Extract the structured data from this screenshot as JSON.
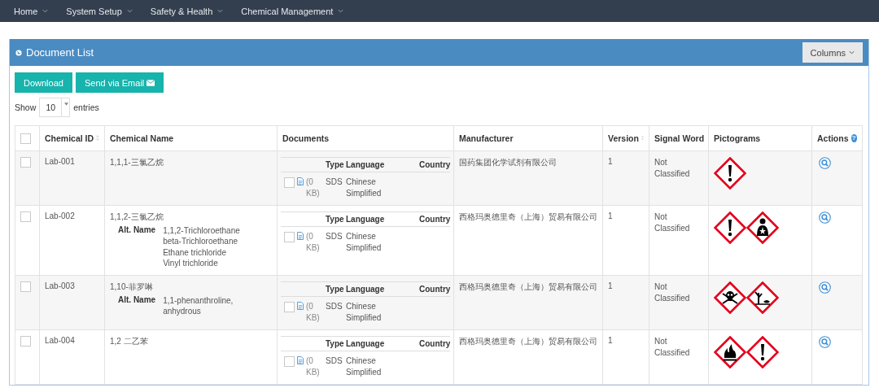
{
  "nav": [
    {
      "label": "Home"
    },
    {
      "label": "System Setup"
    },
    {
      "label": "Safety & Health"
    },
    {
      "label": "Chemical Management"
    }
  ],
  "panel": {
    "title": "Document List",
    "columns_button": "Columns"
  },
  "buttons": [
    {
      "label": "Download",
      "kind": "plain"
    },
    {
      "label": "Send via Email",
      "kind": "email"
    }
  ],
  "length": {
    "before": "Show",
    "value": "10",
    "after": "entries"
  },
  "table": {
    "select_all": {
      "checked": false
    },
    "columns": [
      {
        "label": "Chemical ID",
        "kind": "sortable"
      },
      {
        "label": "Chemical Name",
        "kind": "plain"
      },
      {
        "label": "Documents",
        "kind": "plain"
      },
      {
        "label": "Manufacturer",
        "kind": "plain"
      },
      {
        "label": "Version",
        "kind": "sortable"
      },
      {
        "label": "Signal Word",
        "kind": "plain"
      },
      {
        "label": "Pictograms",
        "kind": "plain"
      },
      {
        "label": "Actions",
        "kind": "help",
        "help_mark": "?"
      }
    ],
    "rows": [
      {
        "checked": false,
        "id": "Lab-001",
        "name": "1,1,1-三氯乙烷",
        "documents": {
          "headers": [
            "Type",
            "Language",
            "Country"
          ],
          "items": [
            {
              "checked": false,
              "size": "(0 KB)",
              "type": "SDS",
              "language": "Chinese Simplified"
            }
          ]
        },
        "manufacturer": "国药集团化学试剂有限公司",
        "version": "1",
        "signal_word": "Not Classified",
        "pictograms": [
          {
            "kind": "exclamation"
          }
        ]
      },
      {
        "checked": false,
        "id": "Lab-002",
        "name": "1,1,2-三氯乙烷",
        "alt_label": "Alt. Name",
        "alt_names": [
          "1,1,2-Trichloroethane",
          "beta-Trichloroethane",
          "Ethane trichloride",
          "Vinyl trichloride"
        ],
        "documents": {
          "headers": [
            "Type",
            "Language",
            "Country"
          ],
          "items": [
            {
              "checked": false,
              "size": "(0 KB)",
              "type": "SDS",
              "language": "Chinese Simplified"
            }
          ]
        },
        "manufacturer": "西格玛奥德里奇（上海）贸易有限公司",
        "version": "1",
        "signal_word": "Not Classified",
        "pictograms": [
          {
            "kind": "exclamation"
          },
          {
            "kind": "health"
          }
        ]
      },
      {
        "checked": false,
        "id": "Lab-003",
        "name": "1,10-菲罗啉",
        "alt_label": "Alt. Name",
        "alt_names": [
          "1,1-phenanthroline, anhydrous"
        ],
        "documents": {
          "headers": [
            "Type",
            "Language",
            "Country"
          ],
          "items": [
            {
              "checked": false,
              "size": "(0 KB)",
              "type": "SDS",
              "language": "Chinese Simplified"
            }
          ]
        },
        "manufacturer": "西格玛奥德里奇（上海）贸易有限公司",
        "version": "1",
        "signal_word": "Not Classified",
        "pictograms": [
          {
            "kind": "skull"
          },
          {
            "kind": "environment"
          }
        ]
      },
      {
        "checked": false,
        "id": "Lab-004",
        "name": "1,2 二乙苯",
        "documents": {
          "headers": [
            "Type",
            "Language",
            "Country"
          ],
          "items": [
            {
              "checked": false,
              "size": "(0 KB)",
              "type": "SDS",
              "language": "Chinese Simplified"
            }
          ]
        },
        "manufacturer": "西格玛奥德里奇（上海）贸易有限公司",
        "version": "1",
        "signal_word": "Not Classified",
        "pictograms": [
          {
            "kind": "flame"
          },
          {
            "kind": "exclamation"
          }
        ]
      }
    ]
  }
}
